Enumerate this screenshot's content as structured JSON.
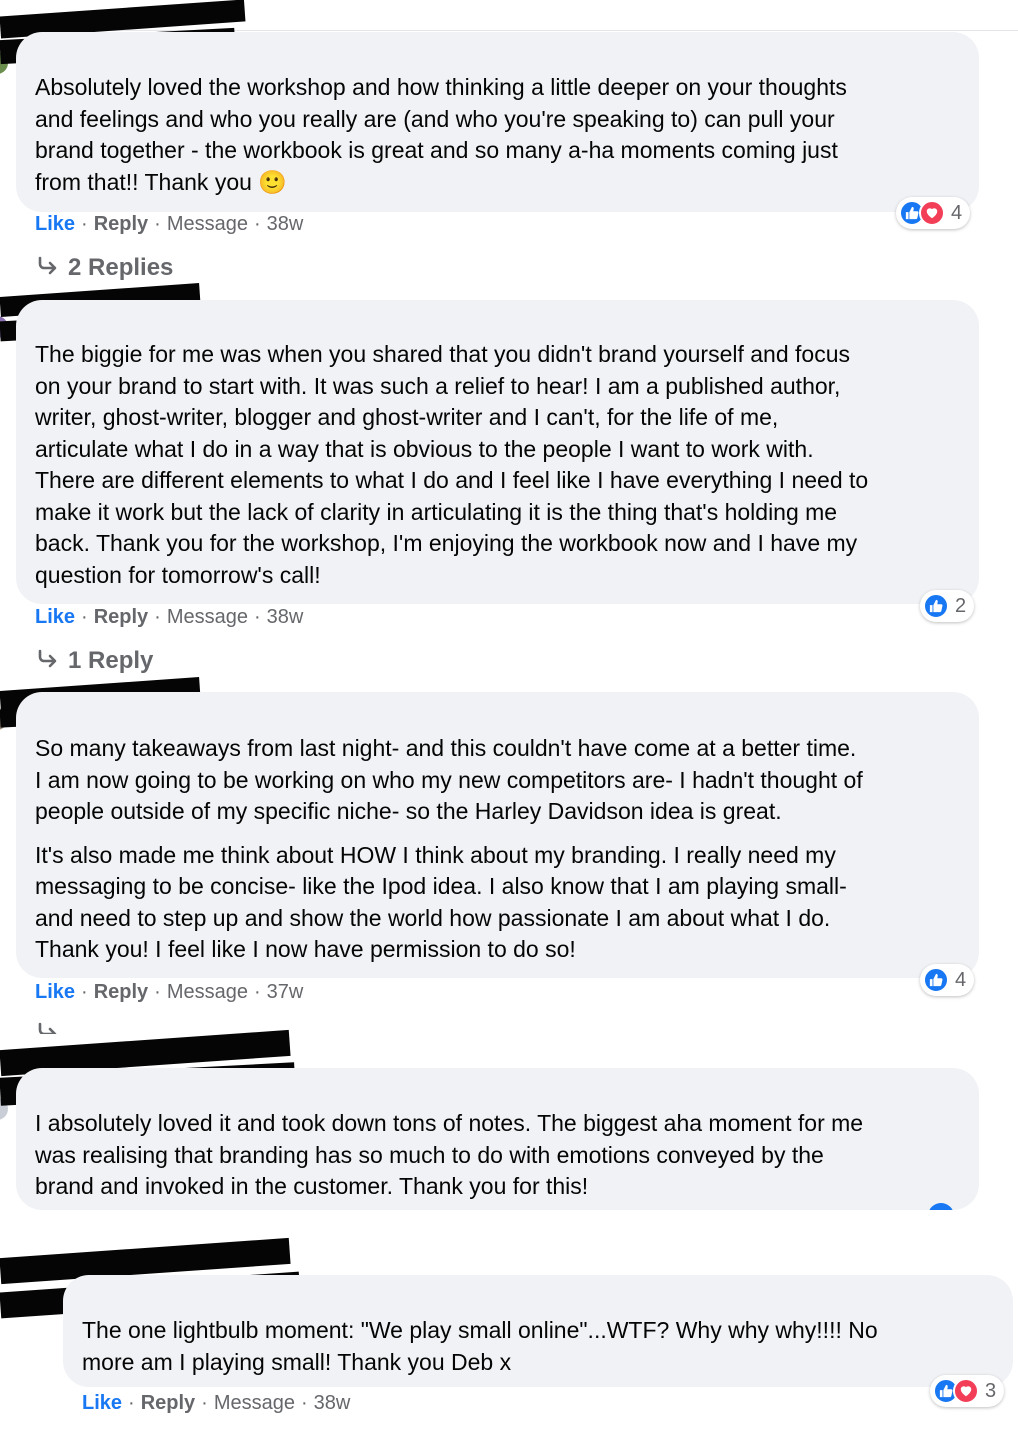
{
  "comments": [
    {
      "paragraphs": [
        [
          "Absolutely loved the workshop and how thinking a little deeper on your thoughts",
          "and feelings and who you really are (and who you're speaking to) can pull your",
          "brand together - the workbook is great and so many a-ha moments coming just",
          "from that!! Thank you 🙂"
        ]
      ],
      "actions": {
        "like": "Like",
        "reply": "Reply",
        "message": "Message",
        "time": "38w"
      },
      "reaction_count": "4",
      "replies_label": "2 Replies"
    },
    {
      "paragraphs": [
        [
          "The biggie for me was when you shared that you didn't brand yourself and focus",
          "on your brand to start with. It was such a relief to hear! I am a published author,",
          "writer, ghost-writer, blogger and ghost-writer and I can't, for the life of me,",
          "articulate what I do in a way that is obvious to the people I want to work with.",
          "There are different elements to what I do and I feel like I have everything I need to",
          "make it work but the lack of clarity in articulating it is the thing that's holding me",
          "back. Thank you for the workshop, I'm enjoying the workbook now and I have my",
          "question for tomorrow's call!"
        ]
      ],
      "actions": {
        "like": "Like",
        "reply": "Reply",
        "message": "Message",
        "time": "38w"
      },
      "reaction_count": "2",
      "replies_label": "1 Reply"
    },
    {
      "paragraphs": [
        [
          "So many takeaways from last night- and this couldn't have come at a better time.",
          "I am now going to be working on who my new competitors are- I hadn't thought of",
          "people outside of my specific niche- so the Harley Davidson idea is great."
        ],
        [
          "It's also made me think about HOW I think about my branding. I really need my",
          "messaging to be concise- like the Ipod idea. I also know that I am playing small-",
          "and need to step up and show the world how passionate I am about what I do.",
          "Thank you! I feel like I now have permission to do so!"
        ]
      ],
      "actions": {
        "like": "Like",
        "reply": "Reply",
        "message": "Message",
        "time": "37w"
      },
      "reaction_count": "4"
    },
    {
      "paragraphs": [
        [
          "I absolutely loved it and took down tons of notes. The biggest aha moment for me",
          "was realising that branding has so much to do with emotions conveyed by the",
          "brand and invoked in the customer. Thank you for this!"
        ]
      ]
    },
    {
      "paragraphs": [
        [
          "The one lightbulb moment: \"We play small online\"...WTF? Why why why!!!! No",
          "more am I playing small! Thank you Deb x"
        ]
      ],
      "actions": {
        "like": "Like",
        "reply": "Reply",
        "message": "Message",
        "time": "38w"
      },
      "reaction_count": "3"
    }
  ],
  "colors": {
    "like_blue": "#1877f2",
    "love_red": "#f33e58",
    "bubble": "#f0f2f5",
    "meta_gray": "#65676b"
  },
  "icons": [
    "like-reaction-icon",
    "love-reaction-icon",
    "reply-arrow-icon"
  ]
}
